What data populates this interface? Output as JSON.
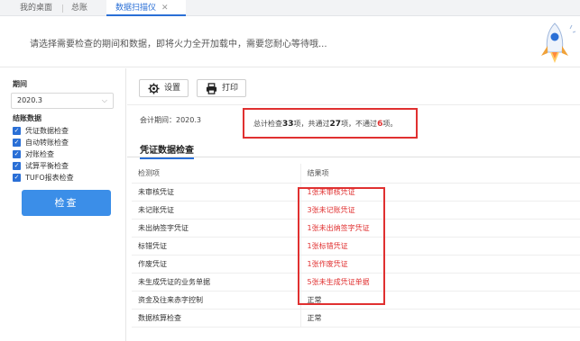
{
  "tabs": [
    {
      "label": "我的桌面"
    },
    {
      "label": "总账"
    },
    {
      "label": "数据扫描仪",
      "active": true
    }
  ],
  "banner": {
    "text": "请选择需要检查的期间和数据，即将火力全开加载中，需要您耐心等待哦..."
  },
  "left": {
    "period_label": "期间",
    "period_value": "2020.3",
    "data_label": "结账数据",
    "checks": [
      "凭证数据检查",
      "自动转账检查",
      "对账检查",
      "试算平衡检查",
      "TUFO报表检查"
    ],
    "check_button": "检查"
  },
  "toolbar": {
    "settings_label": "设置",
    "print_label": "打印"
  },
  "period_line": "会计期间：2020.3",
  "summary": {
    "prefix": "总计检查",
    "total": "33",
    "mid1": "项，共通过",
    "passed": "27",
    "mid2": "项，不通过",
    "failed": "6",
    "suffix": "项。"
  },
  "section_title": "凭证数据检查",
  "table": {
    "headers": [
      "检测项",
      "结果项"
    ],
    "rows": [
      {
        "item": "未审核凭证",
        "result": "1张未审核凭证",
        "status": "fail"
      },
      {
        "item": "未记账凭证",
        "result": "3张未记账凭证",
        "status": "fail"
      },
      {
        "item": "未出纳签字凭证",
        "result": "1张未出纳签字凭证",
        "status": "fail"
      },
      {
        "item": "标错凭证",
        "result": "1张标错凭证",
        "status": "fail"
      },
      {
        "item": "作废凭证",
        "result": "1张作废凭证",
        "status": "fail"
      },
      {
        "item": "未生成凭证的业务单据",
        "result": "5张未生成凭证单据",
        "status": "fail"
      },
      {
        "item": "资金及往来赤字控制",
        "result": "正常",
        "status": "ok"
      },
      {
        "item": "数据核算检查",
        "result": "正常",
        "status": "ok"
      }
    ]
  },
  "colors": {
    "accent": "#2a6fd6",
    "button": "#3b8ee8",
    "error": "#e03030"
  }
}
